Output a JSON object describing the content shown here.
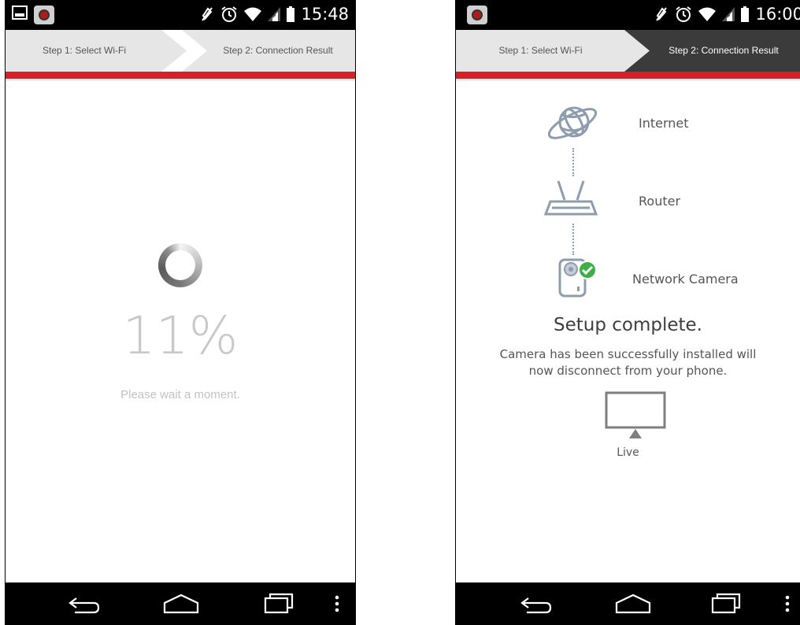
{
  "left_screen": {
    "status_bar": {
      "time": "15:48"
    },
    "steps": {
      "step1": "Step 1: Select Wi-Fi",
      "step2": "Step 2: Connection Result"
    },
    "progress": {
      "percent_text": "11%",
      "value": 11,
      "message": "Please wait a moment."
    }
  },
  "right_screen": {
    "status_bar": {
      "time": "16:00"
    },
    "steps": {
      "step1": "Step 1: Select Wi-Fi",
      "step2": "Step 2: Connection Result"
    },
    "network": {
      "internet_label": "Internet",
      "router_label": "Router",
      "camera_label": "Network Camera"
    },
    "setup": {
      "title": "Setup complete.",
      "message_line1": "Camera has been successfully installed will",
      "message_line2": "now disconnect from your phone."
    },
    "live_label": "Live"
  },
  "colors": {
    "accent_red": "#d81f26",
    "active_step": "#3b3b3b",
    "icon_blue": "#8f9cae",
    "success_green": "#3cb043"
  }
}
